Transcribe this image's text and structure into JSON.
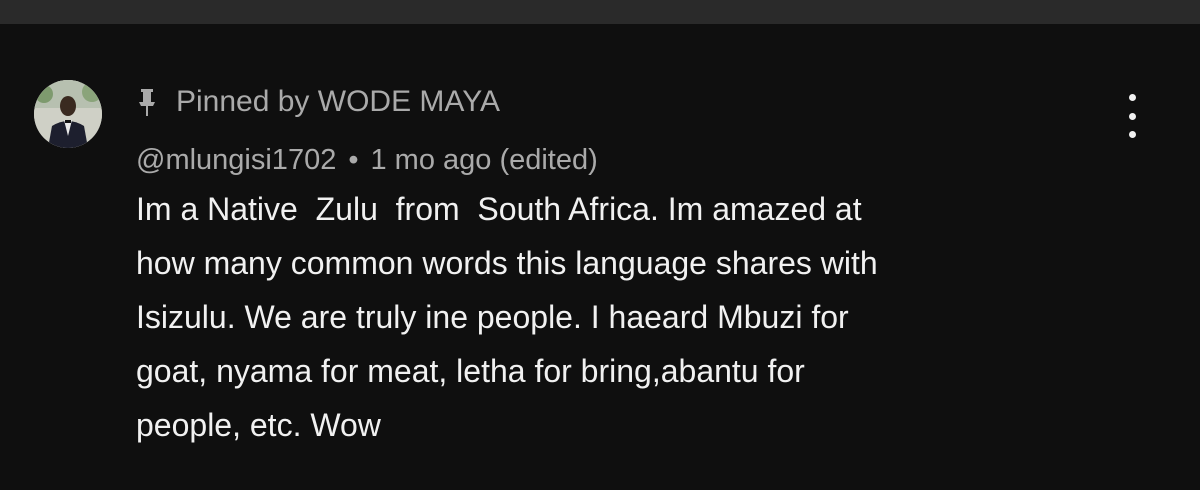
{
  "comment": {
    "pinned_label": "Pinned by WODE MAYA",
    "author": "@mlungisi1702",
    "separator": "•",
    "timestamp": "1 mo ago (edited)",
    "text": "Im a Native  Zulu  from  South Africa. Im amazed at\nhow many common words this language shares with\nIsizulu. We are truly ine people. I haeard Mbuzi for\ngoat, nyama for meat, letha for bring,abantu for\npeople, etc. Wow"
  },
  "icons": {
    "pin": "pin-icon",
    "more": "more-vertical-icon",
    "avatar": "user-avatar"
  },
  "colors": {
    "background": "#0f0f0f",
    "top_bar": "#2a2a2a",
    "primary_text": "#f1f1f1",
    "secondary_text": "#aaaaaa"
  }
}
